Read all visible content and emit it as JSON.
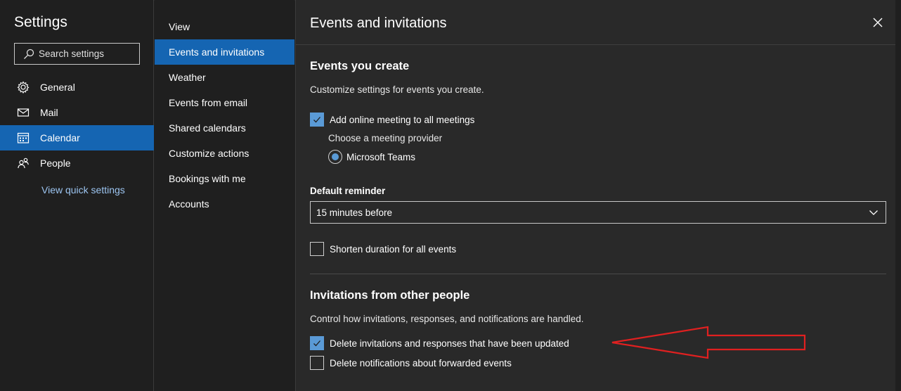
{
  "left": {
    "title": "Settings",
    "search_placeholder": "Search settings",
    "nav": [
      {
        "label": "General",
        "icon": "gear-icon"
      },
      {
        "label": "Mail",
        "icon": "mail-icon"
      },
      {
        "label": "Calendar",
        "icon": "calendar-icon",
        "active": true
      },
      {
        "label": "People",
        "icon": "people-icon"
      }
    ],
    "quick_settings": "View quick settings"
  },
  "middle": {
    "items": [
      {
        "label": "View"
      },
      {
        "label": "Events and invitations",
        "active": true
      },
      {
        "label": "Weather"
      },
      {
        "label": "Events from email"
      },
      {
        "label": "Shared calendars"
      },
      {
        "label": "Customize actions"
      },
      {
        "label": "Bookings with me"
      },
      {
        "label": "Accounts"
      }
    ]
  },
  "right": {
    "title": "Events and invitations",
    "events_you_create": {
      "heading": "Events you create",
      "description": "Customize settings for events you create.",
      "online_meeting_label": "Add online meeting to all meetings",
      "online_meeting_checked": true,
      "provider_label": "Choose a meeting provider",
      "provider_option": "Microsoft Teams",
      "reminder_label": "Default reminder",
      "reminder_value": "15 minutes before",
      "shorten_label": "Shorten duration for all events",
      "shorten_checked": false
    },
    "invitations": {
      "heading": "Invitations from other people",
      "description": "Control how invitations, responses, and notifications are handled.",
      "delete_updated_label": "Delete invitations and responses that have been updated",
      "delete_updated_checked": true,
      "delete_forwarded_label": "Delete notifications about forwarded events",
      "delete_forwarded_checked": false
    }
  },
  "colors": {
    "accent": "#1565b2",
    "checkbox_fill": "#5a9ad6",
    "link": "#9cc4f0",
    "annotation_arrow": "#e02020"
  }
}
